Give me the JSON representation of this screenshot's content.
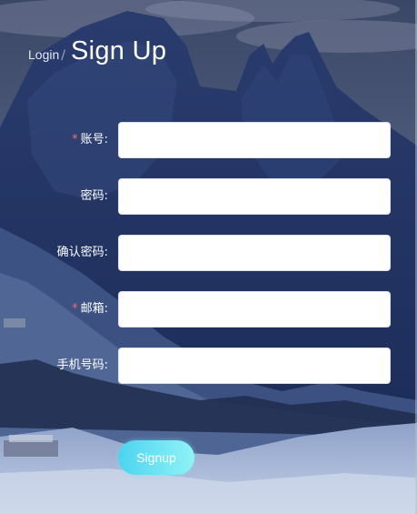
{
  "header": {
    "login_tab": "Login",
    "separator": "/",
    "signup_tab": "Sign Up"
  },
  "form": {
    "fields": [
      {
        "label": "账号:",
        "required": true,
        "value": "",
        "placeholder": ""
      },
      {
        "label": "密码:",
        "required": false,
        "value": "",
        "placeholder": ""
      },
      {
        "label": "确认密码:",
        "required": false,
        "value": "",
        "placeholder": ""
      },
      {
        "label": "邮箱:",
        "required": true,
        "value": "",
        "placeholder": ""
      },
      {
        "label": "手机号码:",
        "required": false,
        "value": "",
        "placeholder": ""
      }
    ],
    "required_mark": "*",
    "submit_label": "Signup"
  },
  "colors": {
    "required_mark": "#f56c6c",
    "button_gradient_start": "#4cd3ef",
    "button_gradient_end": "#8ff3f7",
    "background_sky": "#2a3a63"
  }
}
